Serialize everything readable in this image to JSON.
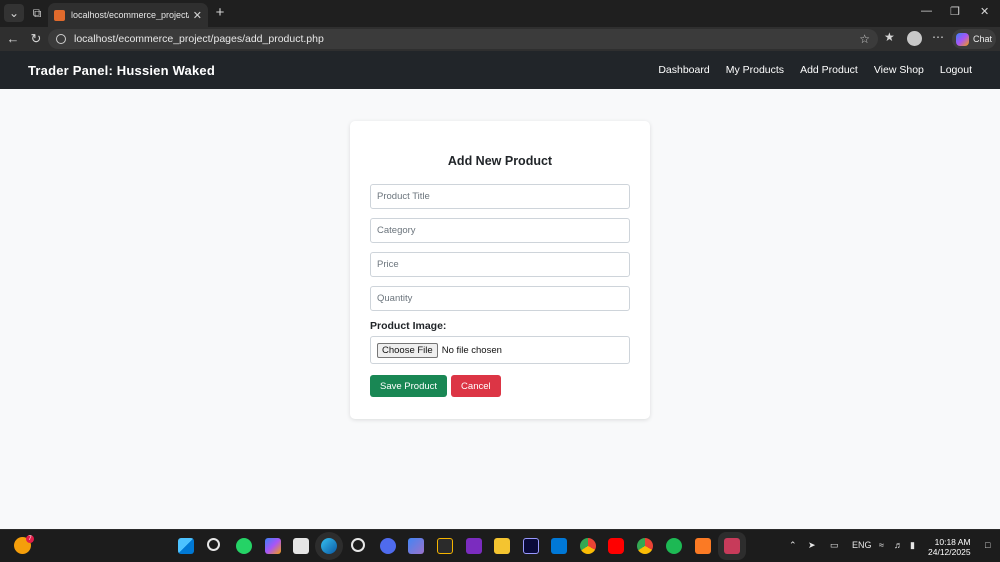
{
  "browser": {
    "tab_title": "localhost/ecommerce_project/pag",
    "url": "localhost/ecommerce_project/pages/add_product.php",
    "chat_label": "Chat"
  },
  "site": {
    "brand": "Trader Panel: Hussien Waked",
    "nav": [
      "Dashboard",
      "My Products",
      "Add Product",
      "View Shop",
      "Logout"
    ]
  },
  "form": {
    "title": "Add New Product",
    "fields": {
      "title_placeholder": "Product Title",
      "category_placeholder": "Category",
      "price_placeholder": "Price",
      "quantity_placeholder": "Quantity"
    },
    "image_label": "Product Image:",
    "choose_file": "Choose File",
    "no_file": "No file chosen",
    "save_label": "Save Product",
    "cancel_label": "Cancel"
  },
  "taskbar": {
    "weather_badge": "7",
    "language": "ENG",
    "time": "10:18 AM",
    "date": "24/12/2025"
  }
}
